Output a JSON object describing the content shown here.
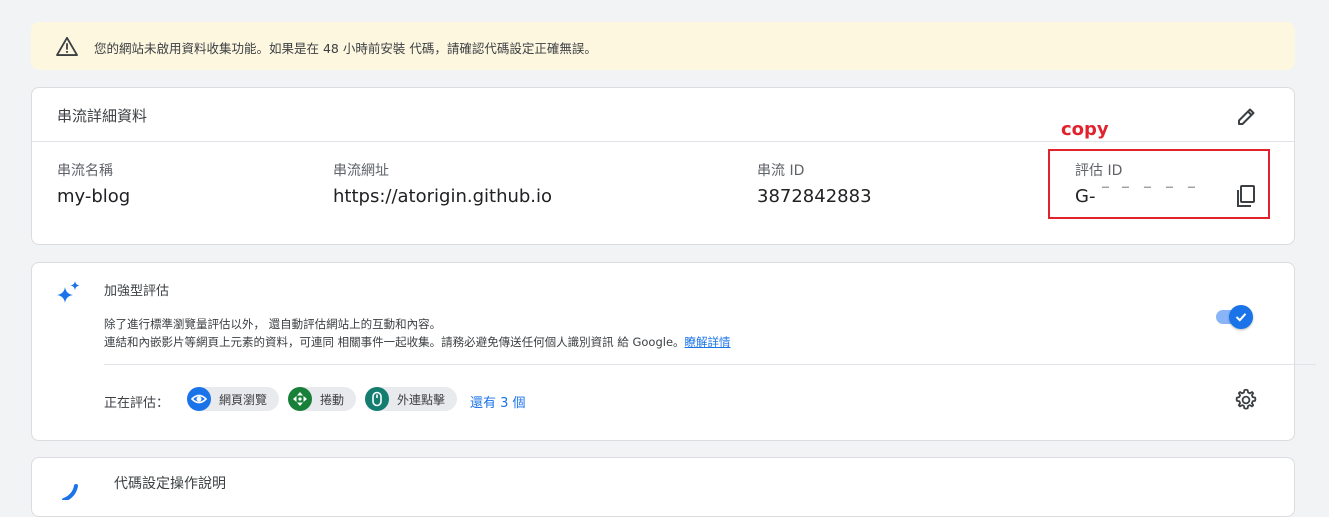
{
  "banner": {
    "icon": "warning-icon",
    "message": "您的網站未啟用資料收集功能。如果是在 48 小時前安裝 代碼，請確認代碼設定正確無誤。"
  },
  "stream_details": {
    "title": "串流詳細資料",
    "edit_icon": "pencil-icon",
    "fields": [
      {
        "label": "串流名稱",
        "value": "my-blog"
      },
      {
        "label": "串流網址",
        "value": "https://atorigin.github.io"
      },
      {
        "label": "串流 ID",
        "value": "3872842883"
      },
      {
        "label": "評估 ID",
        "value": "G-"
      }
    ],
    "copy_icon": "copy-icon"
  },
  "annotation": {
    "text": "copy",
    "color": "#e0232e"
  },
  "enhanced_measurement": {
    "title": "加強型評估",
    "icon": "sparkle-icon",
    "description_line1": "除了進行標準瀏覽量評估以外， 還自動評估網站上的互動和內容。",
    "description_line2": "連結和內嵌影片等網頁上元素的資料，可連同 相關事件一起收集。請務必避免傳送任何個人識別資訊 給 Google。",
    "learn_more": "瞭解詳情",
    "toggle_on": true,
    "measuring_label": "正在評估：",
    "chips": [
      {
        "label": "網頁瀏覽",
        "icon": "eye-icon",
        "color": "#1a73e8"
      },
      {
        "label": "捲動",
        "icon": "scroll-arrows-icon",
        "color": "#188038"
      },
      {
        "label": "外連點擊",
        "icon": "mouse-icon",
        "color": "#137d70"
      }
    ],
    "more": "還有 3 個",
    "settings_icon": "gear-icon"
  },
  "tag_instructions": {
    "title": "代碼設定操作說明"
  },
  "colors": {
    "accent": "#1a73e8",
    "banner_bg": "#fef7e0",
    "page_bg": "#f1f3f4"
  }
}
